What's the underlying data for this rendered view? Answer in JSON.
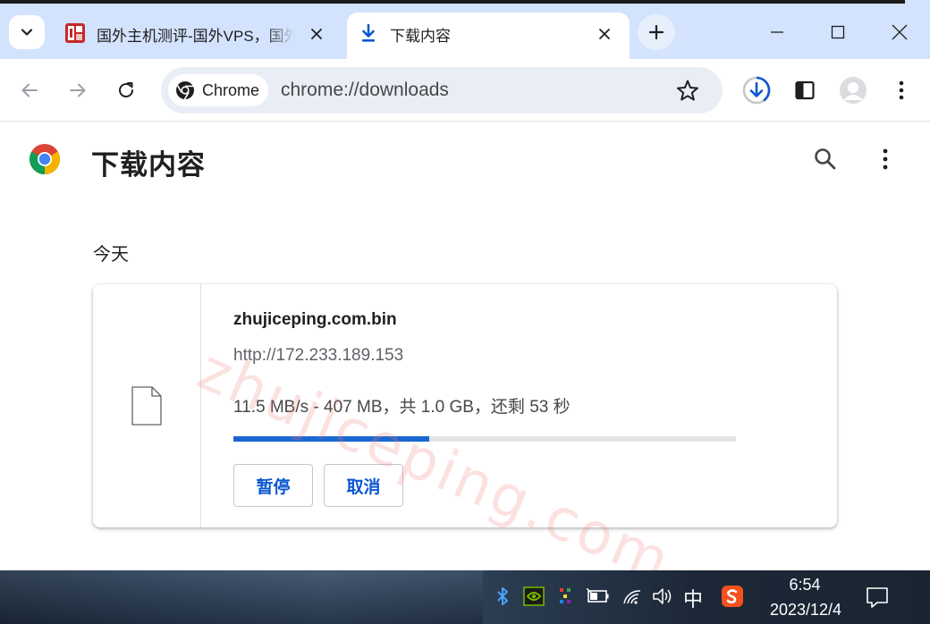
{
  "tabs": [
    {
      "title": "国外主机测评-国外VPS，国外服务器",
      "favicon": "red-site-icon",
      "active": false
    },
    {
      "title": "下载内容",
      "favicon": "download-icon",
      "active": true
    }
  ],
  "omnibox": {
    "chip_label": "Chrome",
    "url": "chrome://downloads"
  },
  "page": {
    "title": "下载内容",
    "section_date": "今天",
    "watermark": "zhujiceping.com"
  },
  "download": {
    "filename": "zhujiceping.com.bin",
    "source_url": "http://172.233.189.153",
    "status": "11.5 MB/s - 407 MB，共 1.0 GB，还剩 53 秒",
    "progress_fraction": 0.39,
    "pause_label": "暂停",
    "cancel_label": "取消"
  },
  "taskbar": {
    "ime": "中",
    "time": "6:54",
    "date": "2023/12/4"
  },
  "colors": {
    "tabstrip": "#d3e3fd",
    "accent": "#0b57d0",
    "progress": "#1a67d2"
  }
}
